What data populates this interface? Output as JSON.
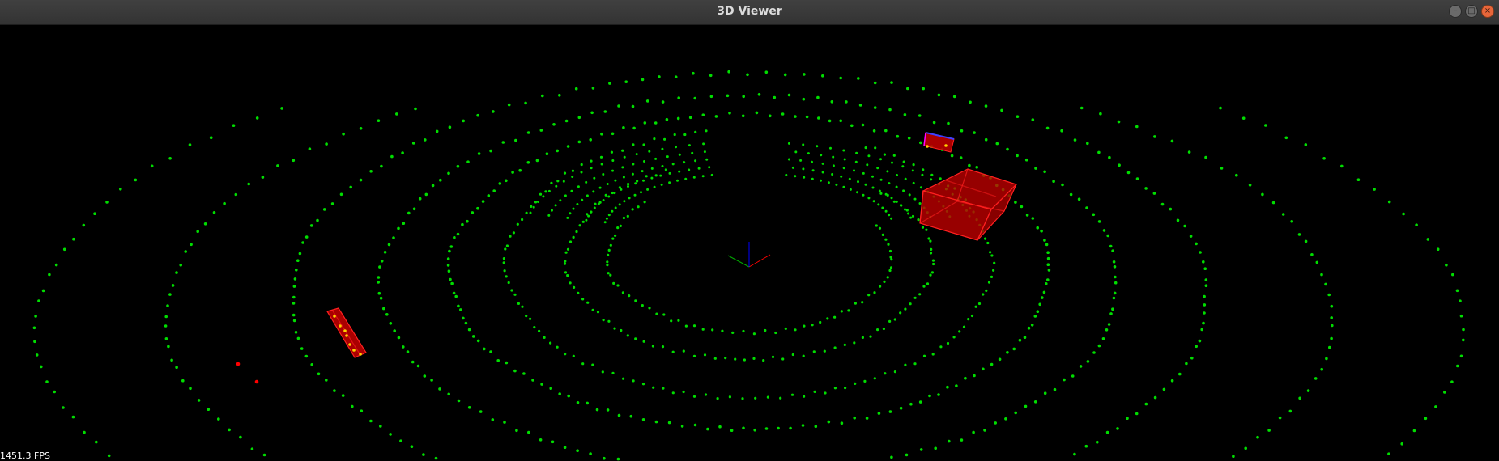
{
  "window": {
    "title": "3D Viewer",
    "buttons": {
      "minimize": "–",
      "maximize": "□",
      "close": "×"
    }
  },
  "viewport": {
    "fps_text": "1451.3 FPS",
    "colors": {
      "background": "#000000",
      "points": "#00dd00",
      "boxes": "#ff0000",
      "box_points": "#ffd000",
      "axis_x": "#ff0000",
      "axis_y": "#00aa00",
      "axis_z": "#0000ff"
    }
  }
}
